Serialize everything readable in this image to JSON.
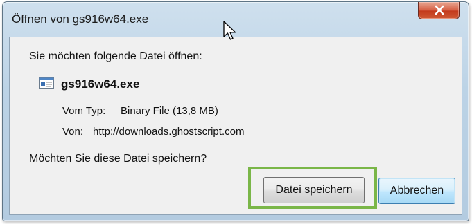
{
  "window": {
    "title": "Öffnen von gs916w64.exe"
  },
  "dialog": {
    "heading": "Sie möchten folgende Datei öffnen:",
    "file_name": "gs916w64.exe",
    "type_label": "Vom Typ:",
    "type_value": "Binary File (13,8 MB)",
    "from_label": "Von:",
    "from_value": "http://downloads.ghostscript.com",
    "question": "Möchten Sie diese Datei speichern?"
  },
  "buttons": {
    "save_label": "Datei speichern",
    "cancel_label": "Abbrechen"
  },
  "icons": {
    "close": "close-icon",
    "file": "executable-file-icon",
    "cursor": "mouse-cursor-icon"
  },
  "colors": {
    "highlight": "#7ab648",
    "close_button": "#c33a1c",
    "default_button_border": "#3c7fb1"
  }
}
